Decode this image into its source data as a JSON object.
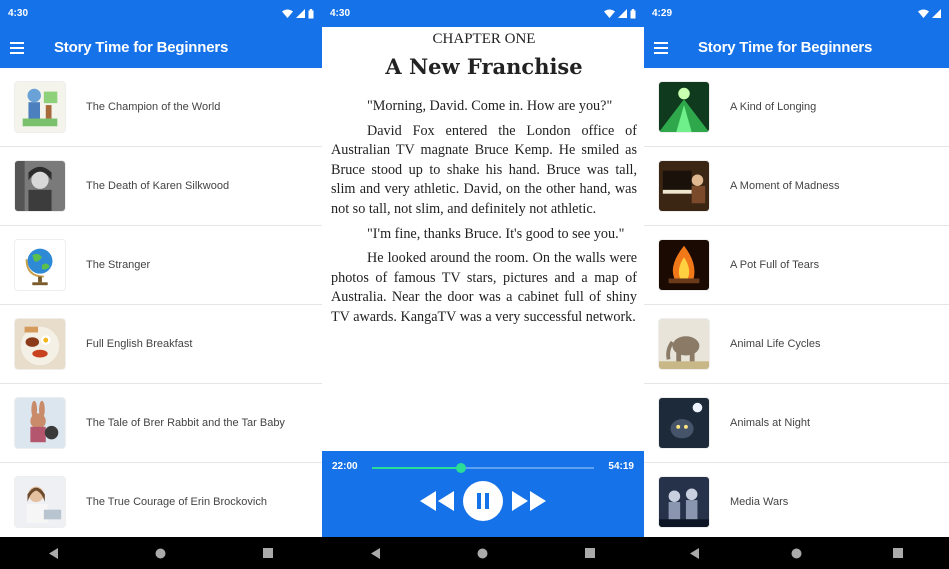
{
  "screen1": {
    "status": {
      "time": "4:30"
    },
    "appbar": {
      "title": "Story Time for Beginners"
    },
    "stories": [
      {
        "title": "The Champion of the World",
        "icon": "champion-thumb"
      },
      {
        "title": "The Death of Karen Silkwood",
        "icon": "karen-silkwood-thumb"
      },
      {
        "title": "The Stranger",
        "icon": "globe-thumb"
      },
      {
        "title": "Full English Breakfast",
        "icon": "breakfast-thumb"
      },
      {
        "title": "The Tale of Brer Rabbit and the Tar Baby",
        "icon": "brer-rabbit-thumb"
      },
      {
        "title": "The True Courage of Erin Brockovich",
        "icon": "erin-brockovich-thumb"
      }
    ]
  },
  "screen2": {
    "status": {
      "time": "4:30"
    },
    "chapter_label": "CHAPTER ONE",
    "chapter_title": "A New Franchise",
    "paragraphs": [
      "\"Morning, David. Come in. How are you?\"",
      "David Fox entered the London office of Australian TV magnate Bruce Kemp. He smiled as Bruce stood up to shake his hand. Bruce was tall, slim and very athletic. David, on the other hand, was not so tall, not slim, and definitely not athletic.",
      "\"I'm fine, thanks Bruce. It's good to see you.\"",
      "He looked around the room. On the walls were photos of famous TV stars, pictures and a map of Australia. Near the door was a cabinet full of shiny TV awards. KangaTV was a very successful network."
    ],
    "player": {
      "elapsed": "22:00",
      "total": "54:19",
      "progress": 0.4
    }
  },
  "screen3": {
    "status": {
      "time": "4:29"
    },
    "appbar": {
      "title": "Story Time for Beginners"
    },
    "stories": [
      {
        "title": "A Kind of Longing",
        "icon": "longing-thumb"
      },
      {
        "title": "A Moment of Madness",
        "icon": "piano-thumb"
      },
      {
        "title": "A Pot Full of Tears",
        "icon": "fire-thumb"
      },
      {
        "title": "Animal Life Cycles",
        "icon": "elephant-thumb"
      },
      {
        "title": "Animals at Night",
        "icon": "night-animal-thumb"
      },
      {
        "title": "Media Wars",
        "icon": "media-wars-thumb"
      }
    ]
  },
  "colors": {
    "primary": "#1672e8",
    "accent": "#2bdc98",
    "navbar": "#000000"
  }
}
